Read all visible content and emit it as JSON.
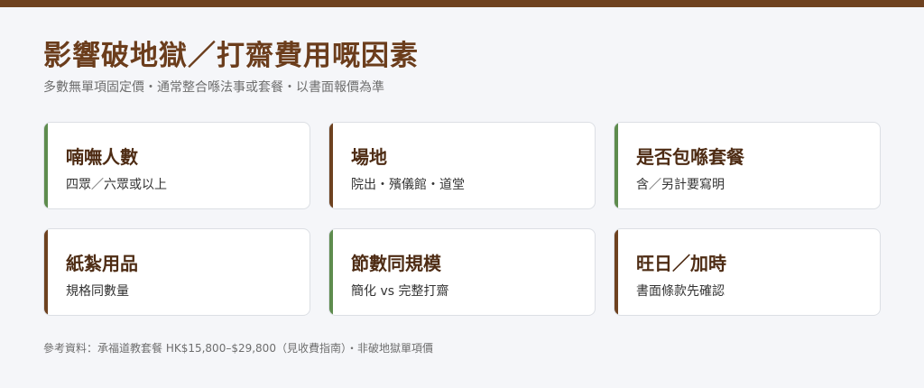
{
  "title": "影響破地獄／打齋費用嘅因素",
  "subtitle": "多數無單項固定價・通常整合喺法事或套餐・以書面報價為準",
  "cards": [
    {
      "title": "喃嘸人數",
      "desc": "四眾／六眾或以上",
      "accent": "#5e8c4e"
    },
    {
      "title": "場地",
      "desc": "院出・殯儀館・道堂",
      "accent": "#6e4220"
    },
    {
      "title": "是否包喺套餐",
      "desc": "含／另計要寫明",
      "accent": "#5e8c4e"
    },
    {
      "title": "紙紮用品",
      "desc": "規格同數量",
      "accent": "#6e4220"
    },
    {
      "title": "節數同規模",
      "desc": "簡化 vs 完整打齋",
      "accent": "#5e8c4e"
    },
    {
      "title": "旺日／加時",
      "desc": "書面條款先確認",
      "accent": "#6e4220"
    }
  ],
  "footnote": "參考資料：承福道教套餐 HK$15,800–$29,800（見收費指南）・非破地獄單項價",
  "colors": {
    "brand": "#6e4220",
    "accent_green": "#5e8c4e",
    "background": "#f5f6f9"
  }
}
